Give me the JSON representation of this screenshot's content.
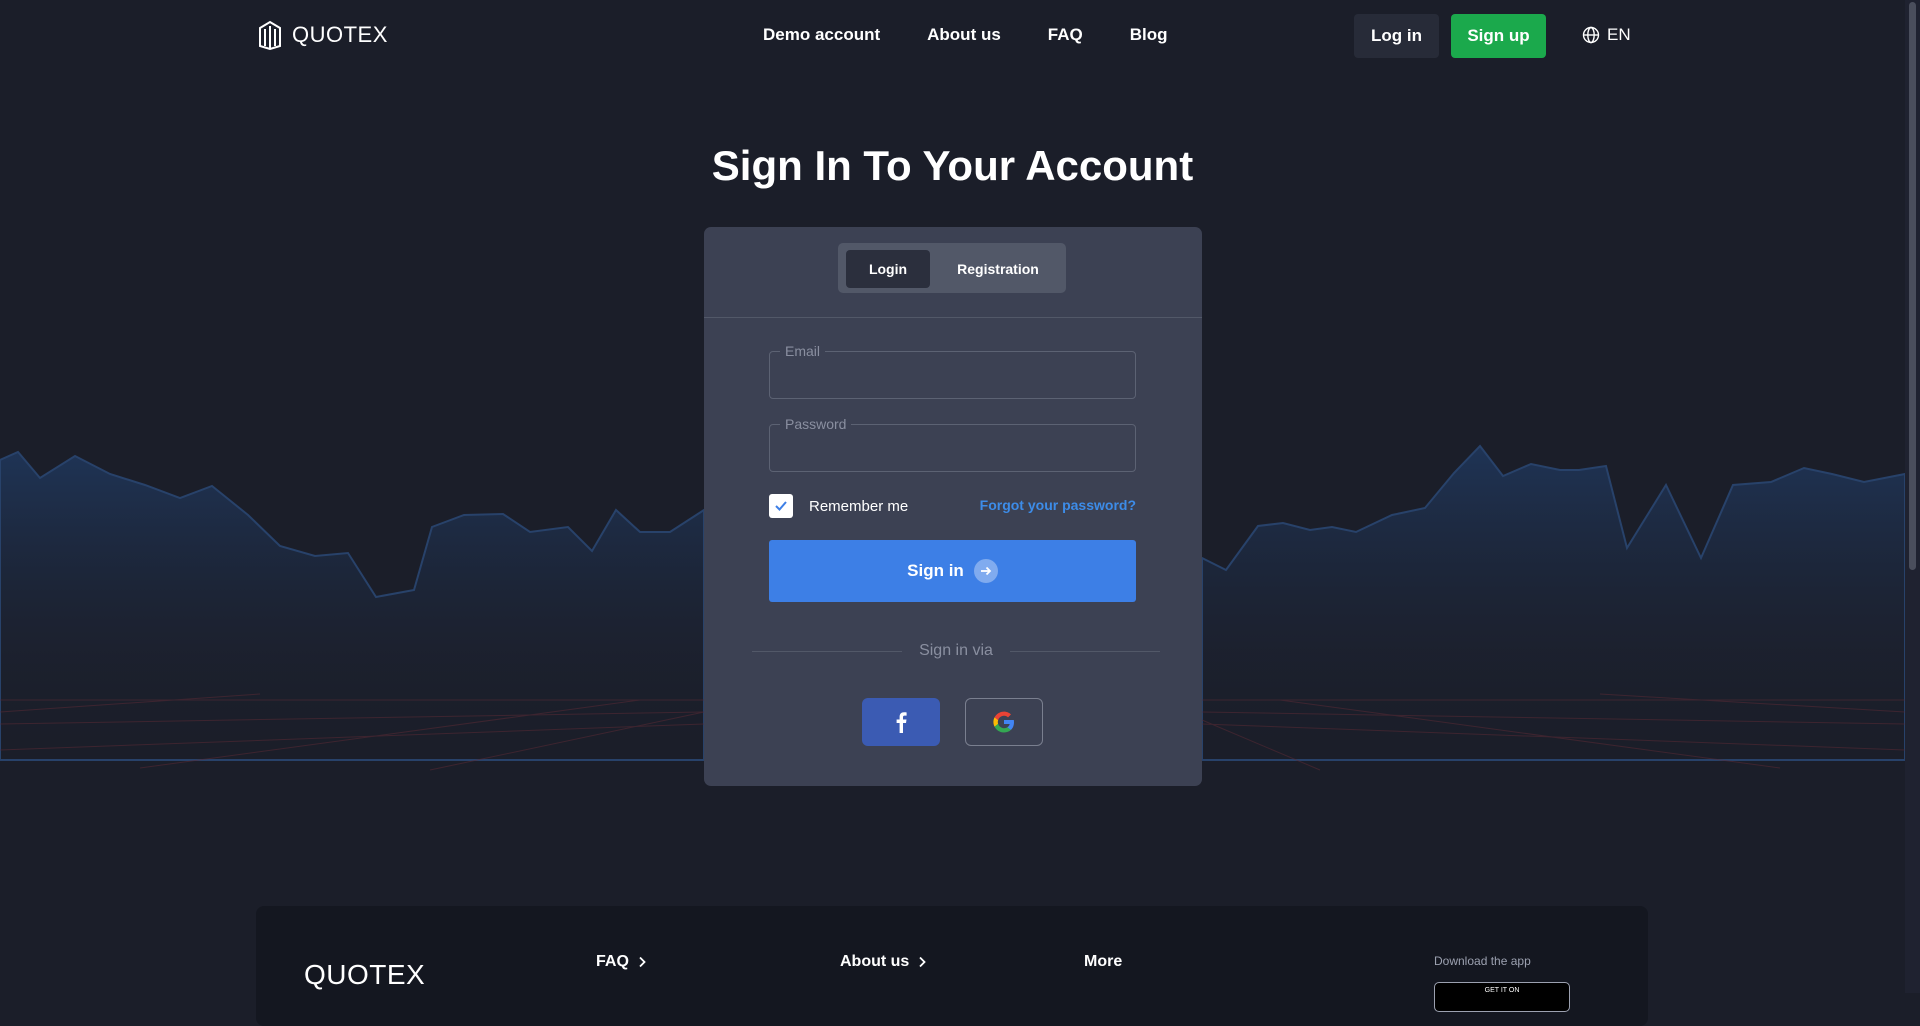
{
  "brand": {
    "name": "QUOTEX"
  },
  "nav": {
    "items": [
      {
        "label": "Demo account"
      },
      {
        "label": "About us"
      },
      {
        "label": "FAQ"
      },
      {
        "label": "Blog"
      }
    ]
  },
  "header": {
    "login_label": "Log in",
    "signup_label": "Sign up",
    "language": "EN"
  },
  "page": {
    "title": "Sign In To Your Account"
  },
  "auth": {
    "tabs": [
      {
        "label": "Login",
        "active": true
      },
      {
        "label": "Registration",
        "active": false
      }
    ],
    "email": {
      "label": "Email",
      "value": ""
    },
    "password": {
      "label": "Password",
      "value": ""
    },
    "remember_label": "Remember me",
    "remember_checked": true,
    "forgot_label": "Forgot your password?",
    "signin_label": "Sign in",
    "via_label": "Sign in via",
    "social": [
      {
        "icon": "facebook-icon"
      },
      {
        "icon": "google-icon"
      }
    ]
  },
  "footer": {
    "logo": "QUOTEX",
    "links": [
      {
        "label": "FAQ"
      },
      {
        "label": "About us"
      },
      {
        "label": "More"
      }
    ],
    "download_label": "Download the app",
    "store_badge_text": "GET IT ON"
  },
  "colors": {
    "background": "#1b1e29",
    "card": "#3c4153",
    "primary": "#3d7fe6",
    "signup": "#1ba94c",
    "link": "#3d8ce8",
    "facebook": "#3b5bb3"
  }
}
